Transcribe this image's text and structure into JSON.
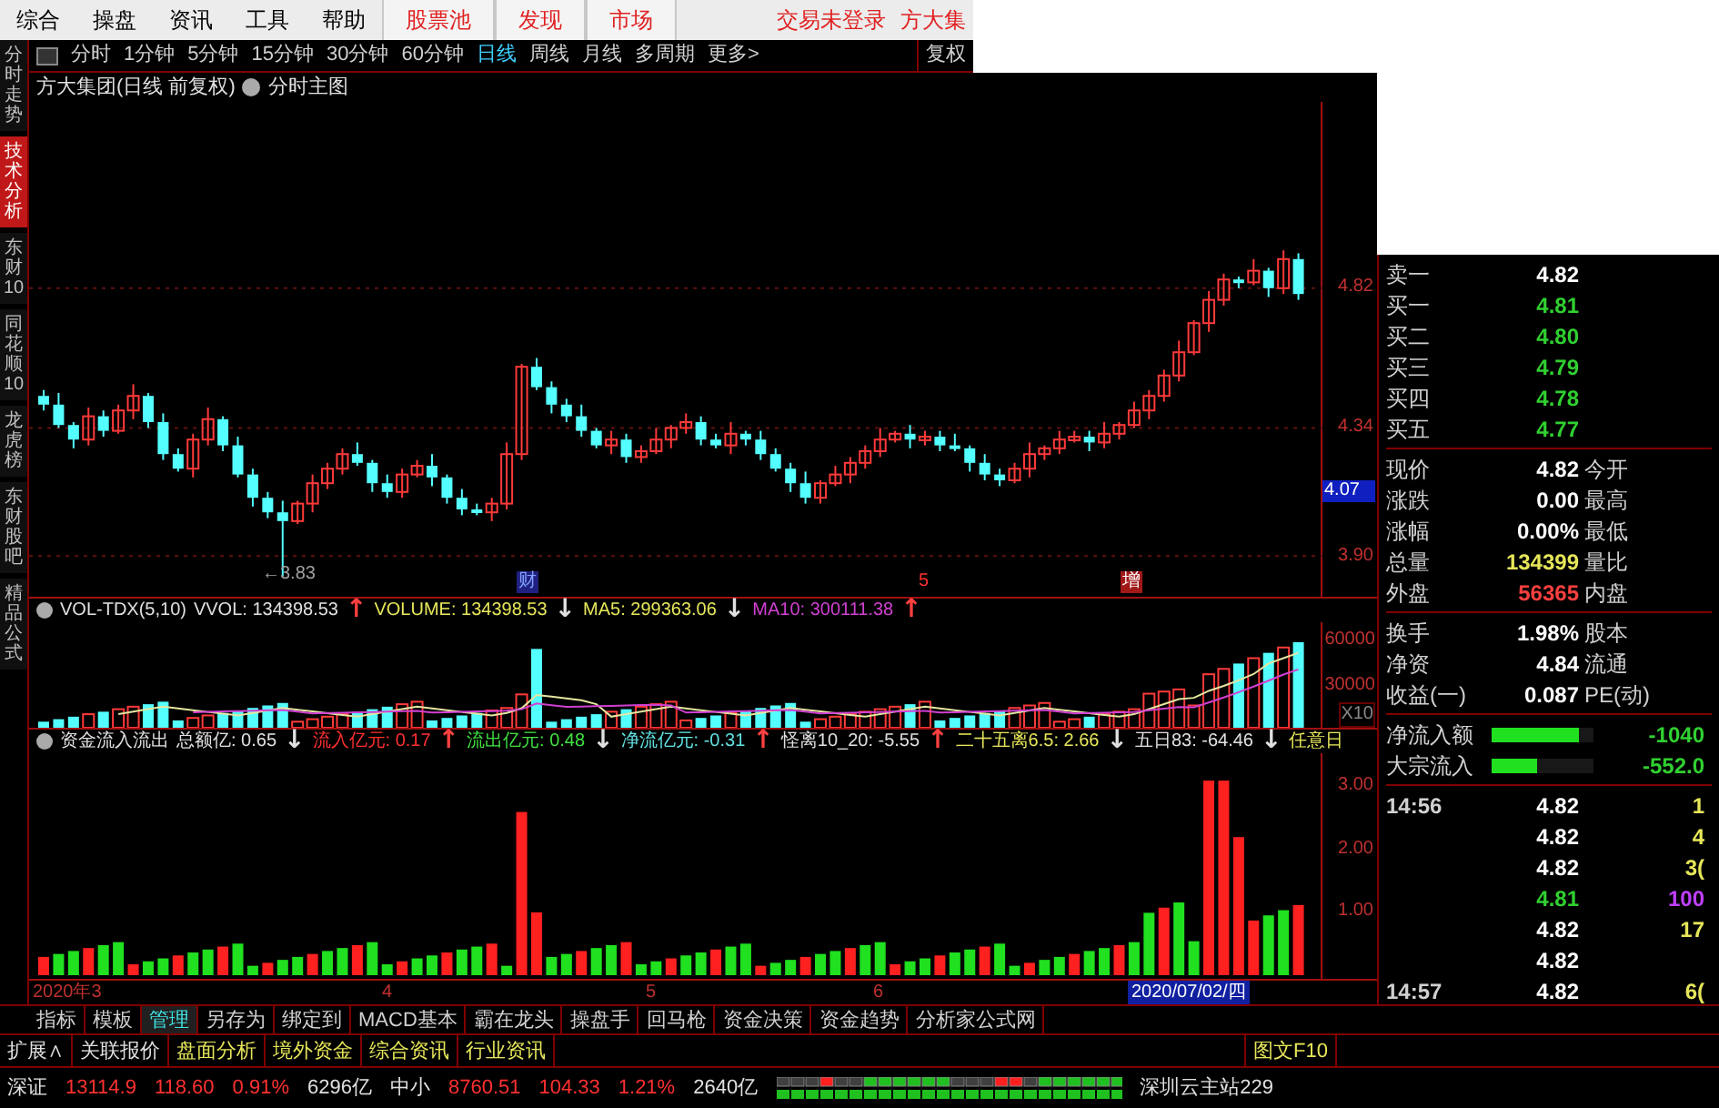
{
  "menu": {
    "items": [
      {
        "label": "综合",
        "kind": "plain"
      },
      {
        "label": "操盘",
        "kind": "plain"
      },
      {
        "label": "资讯",
        "kind": "plain"
      },
      {
        "label": "工具",
        "kind": "plain"
      },
      {
        "label": "帮助",
        "kind": "plain"
      },
      {
        "label": "股票池",
        "kind": "tab"
      },
      {
        "label": "发现",
        "kind": "tab"
      },
      {
        "label": "市场",
        "kind": "tab"
      }
    ],
    "status": [
      "交易未登录",
      "方大集"
    ]
  },
  "sidebar": {
    "tabs": [
      {
        "label": "分时走势",
        "selected": false
      },
      {
        "label": "技术分析",
        "selected": true
      },
      {
        "label": "东财10",
        "selected": false
      },
      {
        "label": "同花顺10",
        "selected": false
      },
      {
        "label": "龙虎榜",
        "selected": false
      },
      {
        "label": "东财股吧",
        "selected": false
      },
      {
        "label": "精品公式",
        "selected": false
      }
    ]
  },
  "toolbar": {
    "periods": [
      {
        "label": "分时",
        "selected": false
      },
      {
        "label": "1分钟",
        "selected": false
      },
      {
        "label": "5分钟",
        "selected": false
      },
      {
        "label": "15分钟",
        "selected": false
      },
      {
        "label": "30分钟",
        "selected": false
      },
      {
        "label": "60分钟",
        "selected": false
      },
      {
        "label": "日线",
        "selected": true
      },
      {
        "label": "周线",
        "selected": false
      },
      {
        "label": "月线",
        "selected": false
      },
      {
        "label": "多周期",
        "selected": false
      },
      {
        "label": "更多>",
        "selected": false
      }
    ],
    "adjust": "复权"
  },
  "chart_title": {
    "stock": "方大集团(日线 前复权)",
    "mode": "分时主图"
  },
  "price_chart": {
    "cursor": {
      "label": "4.07"
    },
    "low_label": "←3.83",
    "markers": [
      {
        "label": "财",
        "kind": "news"
      },
      {
        "label": "5",
        "kind": "plain"
      },
      {
        "label": "增",
        "kind": "event"
      }
    ],
    "chart_data": {
      "type": "candlestick",
      "grid": true,
      "ylim": [
        3.76,
        5.46
      ],
      "yticks": [
        {
          "value": 4.82,
          "label": "4.82"
        },
        {
          "value": 4.34,
          "label": "4.34"
        },
        {
          "value": 3.9,
          "label": "3.90"
        }
      ],
      "ohlc": [
        [
          4.45,
          4.47,
          4.4,
          4.42
        ],
        [
          4.42,
          4.46,
          4.34,
          4.35
        ],
        [
          4.35,
          4.36,
          4.27,
          4.3
        ],
        [
          4.3,
          4.41,
          4.28,
          4.38
        ],
        [
          4.38,
          4.4,
          4.31,
          4.33
        ],
        [
          4.33,
          4.42,
          4.32,
          4.4
        ],
        [
          4.4,
          4.49,
          4.37,
          4.45
        ],
        [
          4.45,
          4.46,
          4.34,
          4.36
        ],
        [
          4.36,
          4.39,
          4.23,
          4.25
        ],
        [
          4.25,
          4.27,
          4.19,
          4.2
        ],
        [
          4.2,
          4.32,
          4.17,
          4.3
        ],
        [
          4.3,
          4.41,
          4.28,
          4.37
        ],
        [
          4.37,
          4.38,
          4.26,
          4.28
        ],
        [
          4.28,
          4.31,
          4.17,
          4.18
        ],
        [
          4.18,
          4.2,
          4.07,
          4.1
        ],
        [
          4.1,
          4.12,
          4.03,
          4.05
        ],
        [
          4.05,
          4.09,
          3.83,
          4.02
        ],
        [
          4.02,
          4.09,
          4.01,
          4.08
        ],
        [
          4.08,
          4.18,
          4.05,
          4.15
        ],
        [
          4.15,
          4.22,
          4.13,
          4.2
        ],
        [
          4.2,
          4.27,
          4.18,
          4.25
        ],
        [
          4.25,
          4.29,
          4.21,
          4.22
        ],
        [
          4.22,
          4.23,
          4.12,
          4.15
        ],
        [
          4.15,
          4.18,
          4.1,
          4.12
        ],
        [
          4.12,
          4.2,
          4.1,
          4.18
        ],
        [
          4.18,
          4.23,
          4.17,
          4.21
        ],
        [
          4.21,
          4.25,
          4.14,
          4.17
        ],
        [
          4.17,
          4.18,
          4.08,
          4.1
        ],
        [
          4.1,
          4.13,
          4.04,
          4.06
        ],
        [
          4.06,
          4.08,
          4.04,
          4.05
        ],
        [
          4.05,
          4.1,
          4.02,
          4.08
        ],
        [
          4.08,
          4.29,
          4.06,
          4.25
        ],
        [
          4.25,
          4.56,
          4.23,
          4.55
        ],
        [
          4.55,
          4.58,
          4.47,
          4.48
        ],
        [
          4.48,
          4.5,
          4.39,
          4.42
        ],
        [
          4.42,
          4.44,
          4.36,
          4.38
        ],
        [
          4.38,
          4.42,
          4.31,
          4.33
        ],
        [
          4.33,
          4.34,
          4.27,
          4.28
        ],
        [
          4.28,
          4.33,
          4.25,
          4.3
        ],
        [
          4.3,
          4.32,
          4.22,
          4.24
        ],
        [
          4.24,
          4.28,
          4.22,
          4.26
        ],
        [
          4.26,
          4.34,
          4.25,
          4.3
        ],
        [
          4.3,
          4.35,
          4.27,
          4.34
        ],
        [
          4.34,
          4.39,
          4.32,
          4.36
        ],
        [
          4.36,
          4.38,
          4.28,
          4.3
        ],
        [
          4.3,
          4.32,
          4.27,
          4.28
        ],
        [
          4.28,
          4.36,
          4.25,
          4.32
        ],
        [
          4.32,
          4.33,
          4.28,
          4.3
        ],
        [
          4.3,
          4.33,
          4.23,
          4.25
        ],
        [
          4.25,
          4.27,
          4.19,
          4.2
        ],
        [
          4.2,
          4.22,
          4.12,
          4.15
        ],
        [
          4.15,
          4.19,
          4.08,
          4.1
        ],
        [
          4.1,
          4.16,
          4.08,
          4.15
        ],
        [
          4.15,
          4.21,
          4.14,
          4.18
        ],
        [
          4.18,
          4.24,
          4.15,
          4.22
        ],
        [
          4.22,
          4.28,
          4.2,
          4.26
        ],
        [
          4.26,
          4.34,
          4.24,
          4.3
        ],
        [
          4.3,
          4.33,
          4.29,
          4.32
        ],
        [
          4.32,
          4.35,
          4.27,
          4.3
        ],
        [
          4.3,
          4.33,
          4.28,
          4.31
        ],
        [
          4.31,
          4.33,
          4.26,
          4.28
        ],
        [
          4.28,
          4.32,
          4.26,
          4.27
        ],
        [
          4.27,
          4.28,
          4.19,
          4.22
        ],
        [
          4.22,
          4.25,
          4.16,
          4.18
        ],
        [
          4.18,
          4.2,
          4.14,
          4.16
        ],
        [
          4.16,
          4.22,
          4.15,
          4.2
        ],
        [
          4.2,
          4.29,
          4.17,
          4.25
        ],
        [
          4.25,
          4.28,
          4.23,
          4.27
        ],
        [
          4.27,
          4.33,
          4.25,
          4.3
        ],
        [
          4.3,
          4.33,
          4.29,
          4.31
        ],
        [
          4.31,
          4.33,
          4.26,
          4.29
        ],
        [
          4.29,
          4.36,
          4.27,
          4.32
        ],
        [
          4.32,
          4.36,
          4.3,
          4.35
        ],
        [
          4.35,
          4.43,
          4.34,
          4.4
        ],
        [
          4.4,
          4.47,
          4.37,
          4.45
        ],
        [
          4.45,
          4.54,
          4.43,
          4.52
        ],
        [
          4.52,
          4.64,
          4.5,
          4.6
        ],
        [
          4.6,
          4.71,
          4.59,
          4.7
        ],
        [
          4.7,
          4.81,
          4.67,
          4.78
        ],
        [
          4.78,
          4.87,
          4.76,
          4.85
        ],
        [
          4.85,
          4.86,
          4.82,
          4.84
        ],
        [
          4.84,
          4.92,
          4.83,
          4.88
        ],
        [
          4.88,
          4.89,
          4.79,
          4.82
        ],
        [
          4.82,
          4.95,
          4.8,
          4.92
        ],
        [
          4.92,
          4.94,
          4.78,
          4.8
        ]
      ]
    }
  },
  "volume_panel": {
    "legend": [
      {
        "text": "VOL-TDX(5,10)",
        "color": "#e0e0e0"
      },
      {
        "text": "VVOL: 134398.53",
        "color": "#e0e0e0"
      },
      {
        "text": "↑",
        "color": "#ff4040"
      },
      {
        "text": "VOLUME: 134398.53",
        "color": "#e6e65a"
      },
      {
        "text": "↓",
        "color": "#e0e0e0"
      },
      {
        "text": "MA5: 299363.06",
        "color": "#e6e65a"
      },
      {
        "text": "↓",
        "color": "#e0e0e0"
      },
      {
        "text": "MA10: 300111.38",
        "color": "#d040d0"
      },
      {
        "text": "↑",
        "color": "#ff4040"
      }
    ],
    "axis": [
      "60000",
      "30000",
      "X10"
    ]
  },
  "fund_panel": {
    "legend": [
      {
        "text": "资金流入流出",
        "color": "#e0e0e0"
      },
      {
        "text": "总额亿: 0.65",
        "color": "#e0e0e0"
      },
      {
        "text": "↓",
        "color": "#e0e0e0"
      },
      {
        "text": "流入亿元: 0.17",
        "color": "#ff3030"
      },
      {
        "text": "↑",
        "color": "#ff4040"
      },
      {
        "text": "流出亿元: 0.48",
        "color": "#40e040"
      },
      {
        "text": "↓",
        "color": "#e0e0e0"
      },
      {
        "text": "净流亿元: -0.31",
        "color": "#60e0e0"
      },
      {
        "text": "↑",
        "color": "#ff4040"
      },
      {
        "text": "怪离10_20: -5.55",
        "color": "#e0e0e0"
      },
      {
        "text": "↑",
        "color": "#ff4040"
      },
      {
        "text": "二十五离6.5: 2.66",
        "color": "#e6e65a"
      },
      {
        "text": "↓",
        "color": "#e0e0e0"
      },
      {
        "text": "五日83: -64.46",
        "color": "#e0e0e0"
      },
      {
        "text": "↓",
        "color": "#e0e0e0"
      },
      {
        "text": "任意日",
        "color": "#e6e65a"
      }
    ],
    "axis": [
      "3.00",
      "2.00",
      "1.00"
    ]
  },
  "date_axis": [
    {
      "label": "2020年3",
      "highlight": false
    },
    {
      "label": "4",
      "highlight": false
    },
    {
      "label": "5",
      "highlight": false
    },
    {
      "label": "6",
      "highlight": false
    },
    {
      "label": "2020/07/02/四",
      "highlight": true
    }
  ],
  "quote": {
    "order_book": [
      {
        "label": "卖一",
        "price": "4.82",
        "color": "#ffffff"
      },
      {
        "label": "买一",
        "price": "4.81",
        "color": "#30d030"
      },
      {
        "label": "买二",
        "price": "4.80",
        "color": "#30d030"
      },
      {
        "label": "买三",
        "price": "4.79",
        "color": "#30d030"
      },
      {
        "label": "买四",
        "price": "4.78",
        "color": "#30d030"
      },
      {
        "label": "买五",
        "price": "4.77",
        "color": "#30d030"
      }
    ],
    "stats": [
      {
        "label": "现价",
        "value": "4.82",
        "label2": "今开",
        "color": "#ffffff"
      },
      {
        "label": "涨跌",
        "value": "0.00",
        "label2": "最高",
        "color": "#ffffff"
      },
      {
        "label": "涨幅",
        "value": "0.00%",
        "label2": "最低",
        "color": "#ffffff"
      },
      {
        "label": "总量",
        "value": "134399",
        "label2": "量比",
        "color": "#e6e65a"
      },
      {
        "label": "外盘",
        "value": "56365",
        "label2": "内盘",
        "color": "#ff4040"
      }
    ],
    "fundamentals": [
      {
        "label": "换手",
        "value": "1.98%",
        "label2": "股本"
      },
      {
        "label": "净资",
        "value": "4.84",
        "label2": "流通"
      },
      {
        "label": "收益(一)",
        "value": "0.087",
        "label2": "PE(动)"
      }
    ],
    "flows": [
      {
        "label": "净流入额",
        "level": 0.85,
        "value": "-1040"
      },
      {
        "label": "大宗流入",
        "level": 0.45,
        "value": "-552.0"
      }
    ],
    "ticks": [
      {
        "time": "14:56",
        "price": {
          "text": "4.82",
          "color": "#ffffff"
        },
        "volume": {
          "text": "1",
          "color": "#e6e65a"
        }
      },
      {
        "price": {
          "text": "4.82",
          "color": "#ffffff"
        },
        "volume": {
          "text": "4",
          "color": "#e6e65a"
        }
      },
      {
        "price": {
          "text": "4.82",
          "color": "#ffffff"
        },
        "volume": {
          "text": "3(",
          "color": "#e6e65a"
        }
      },
      {
        "price": {
          "text": "4.81",
          "color": "#30d030"
        },
        "volume": {
          "text": "100",
          "color": "#c040ff"
        }
      },
      {
        "price": {
          "text": "4.82",
          "color": "#ffffff"
        },
        "volume": {
          "text": "17",
          "color": "#e6e65a"
        }
      },
      {
        "price": {
          "text": "4.82",
          "color": "#ffffff"
        }
      },
      {
        "time": "14:57",
        "price": {
          "text": "4.82",
          "color": "#ffffff"
        },
        "volume": {
          "text": "6(",
          "color": "#e6e65a"
        }
      }
    ]
  },
  "indicator_tabs": [
    {
      "label": "指标",
      "selected": false
    },
    {
      "label": "模板",
      "selected": false
    },
    {
      "label": "管理",
      "selected": true
    },
    {
      "label": "另存为",
      "selected": false
    },
    {
      "label": "绑定到",
      "selected": false
    },
    {
      "label": "MACD基本",
      "selected": false
    },
    {
      "label": "霸在龙头",
      "selected": false
    },
    {
      "label": "操盘手",
      "selected": false
    },
    {
      "label": "回马枪",
      "selected": false
    },
    {
      "label": "资金决策",
      "selected": false
    },
    {
      "label": "资金趋势",
      "selected": false
    },
    {
      "label": "分析家公式网",
      "selected": false
    }
  ],
  "info_tabs": [
    {
      "label": "扩展∧",
      "color": "#e0e0e0"
    },
    {
      "label": "关联报价",
      "color": "#e0e0e0"
    },
    {
      "label": "盘面分析",
      "color": "#e6e65a"
    },
    {
      "label": "境外资金",
      "color": "#e6e65a"
    },
    {
      "label": "综合资讯",
      "color": "#e6e65a"
    },
    {
      "label": "行业资讯",
      "color": "#e6e65a"
    }
  ],
  "f10": "图文F10",
  "status_bar": {
    "items": [
      {
        "text": "深证",
        "color": "#e0e0e0"
      },
      {
        "text": "13114.9",
        "color": "#ff3030"
      },
      {
        "text": "118.60",
        "color": "#ff3030"
      },
      {
        "text": "0.91%",
        "color": "#ff3030"
      },
      {
        "text": "6296亿",
        "color": "#e0e0e0"
      },
      {
        "text": "中小",
        "color": "#e0e0e0"
      },
      {
        "text": "8760.51",
        "color": "#ff3030"
      },
      {
        "text": "104.33",
        "color": "#ff3030"
      },
      {
        "text": "1.21%",
        "color": "#ff3030"
      },
      {
        "text": "2640亿",
        "color": "#e0e0e0"
      }
    ],
    "server": "深圳云主站229"
  }
}
